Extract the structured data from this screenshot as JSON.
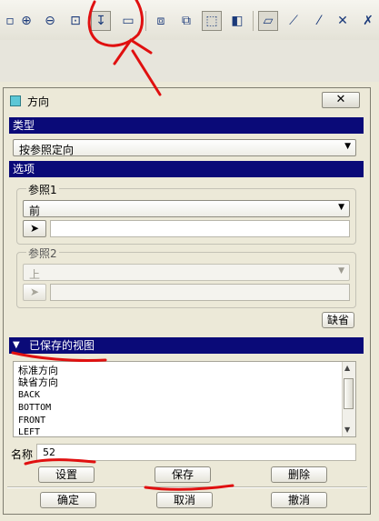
{
  "toolbar": {
    "icons": [
      "zoom-in-icon",
      "zoom-out-icon",
      "zoom-fit-icon",
      "reorient-icon",
      "saved-views-icon",
      "wireframe-cube-icon",
      "hidden-line-cube-icon",
      "no-hidden-cube-icon",
      "shaded-cube-icon",
      "datum-plane-icon",
      "datum-axis-icon",
      "datum-point-icon",
      "coord-sys-icon",
      "axis-label-icon"
    ]
  },
  "dialog": {
    "title": "方向",
    "close_label": "✕",
    "type_section": {
      "header": "类型",
      "selected": "按参照定向"
    },
    "options_section": {
      "header": "选项",
      "ref1": {
        "label": "参照1",
        "value": "前"
      },
      "ref2": {
        "label": "参照2",
        "value": "上"
      },
      "default_button": "缺省"
    },
    "saved_views": {
      "header": "已保存的视图",
      "items": [
        "标准方向",
        "缺省方向",
        "BACK",
        "BOTTOM",
        "FRONT",
        "LEFT"
      ],
      "name_label": "名称",
      "name_value": "52",
      "set_button": "设置",
      "save_button": "保存",
      "delete_button": "删除"
    },
    "footer": {
      "ok_button": "确定",
      "cancel_button": "取消",
      "undo_button": "撤消"
    }
  },
  "colors": {
    "section_header_bg": "#0a0a78",
    "dialog_bg": "#ece9d8",
    "annotation_red": "#e01010"
  }
}
